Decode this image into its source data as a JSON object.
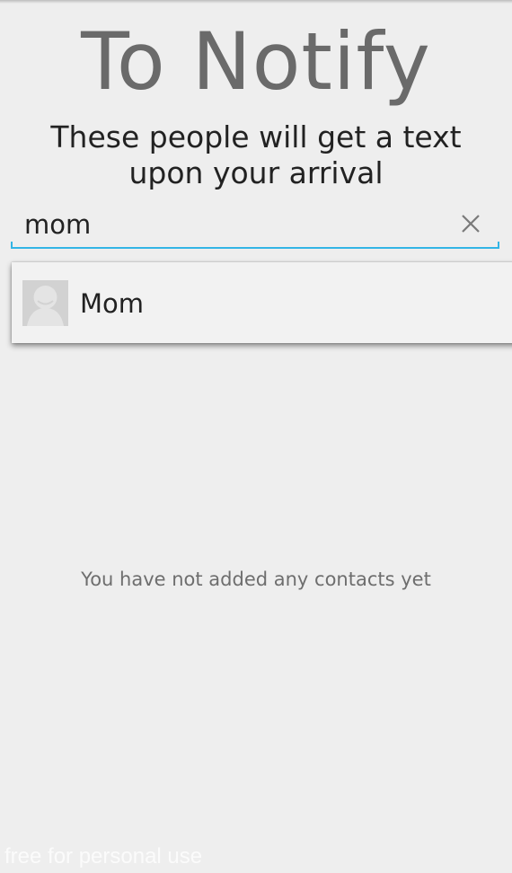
{
  "header": {
    "title": "To Notify",
    "subtitle": "These people will get a text upon your arrival"
  },
  "search": {
    "value": "mom",
    "clear_icon": "close-icon",
    "accent_color": "#33b5e5"
  },
  "suggestions": [
    {
      "name": "Mom",
      "avatar_icon": "default-contact-avatar"
    }
  ],
  "contacts": {
    "empty_message": "You have not added any contacts yet"
  },
  "watermark": {
    "text": "free for personal use"
  }
}
